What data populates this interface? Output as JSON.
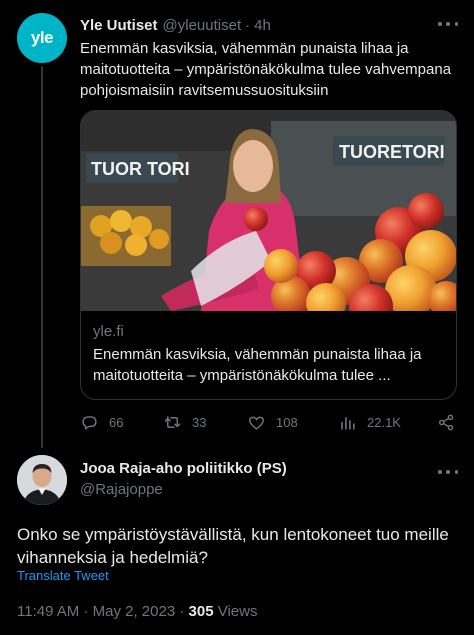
{
  "tweet1": {
    "avatar_text": "yle",
    "name": "Yle Uutiset",
    "handle": "@yleuutiset",
    "time": "4h",
    "text": "Enemmän kasviksia, vähemmän punaista lihaa ja maitotuotteita – ympäristönäkökulma tulee vahvempana pohjoismaisiin ravitsemussuosituksiin",
    "card": {
      "sign_left": "TUOR TORI",
      "sign_right": "TUORETORI",
      "domain": "yle.fi",
      "title": "Enemmän kasviksia, vähemmän punaista lihaa ja maitotuotteita – ympäristönäkökulma tulee ..."
    },
    "actions": {
      "replies": "66",
      "retweets": "33",
      "likes": "108",
      "views": "22.1K"
    }
  },
  "tweet2": {
    "name": "Jooa Raja-aho poliitikko (PS)",
    "handle": "@Rajajoppe",
    "text": "Onko se ympäristöystävällistä, kun lentokoneet tuo meille vihanneksia ja hedelmiä?",
    "translate": "Translate Tweet",
    "time": "11:49 AM",
    "separator": "·",
    "date": "May 2, 2023",
    "separator2": "·",
    "views_count": "305",
    "views_label": "Views"
  },
  "colors": {
    "background": "#000000",
    "text": "#e7e9ea",
    "muted": "#71767b",
    "link": "#1d9bf0",
    "yle_brand": "#00b4c8",
    "border": "#2f3336"
  }
}
